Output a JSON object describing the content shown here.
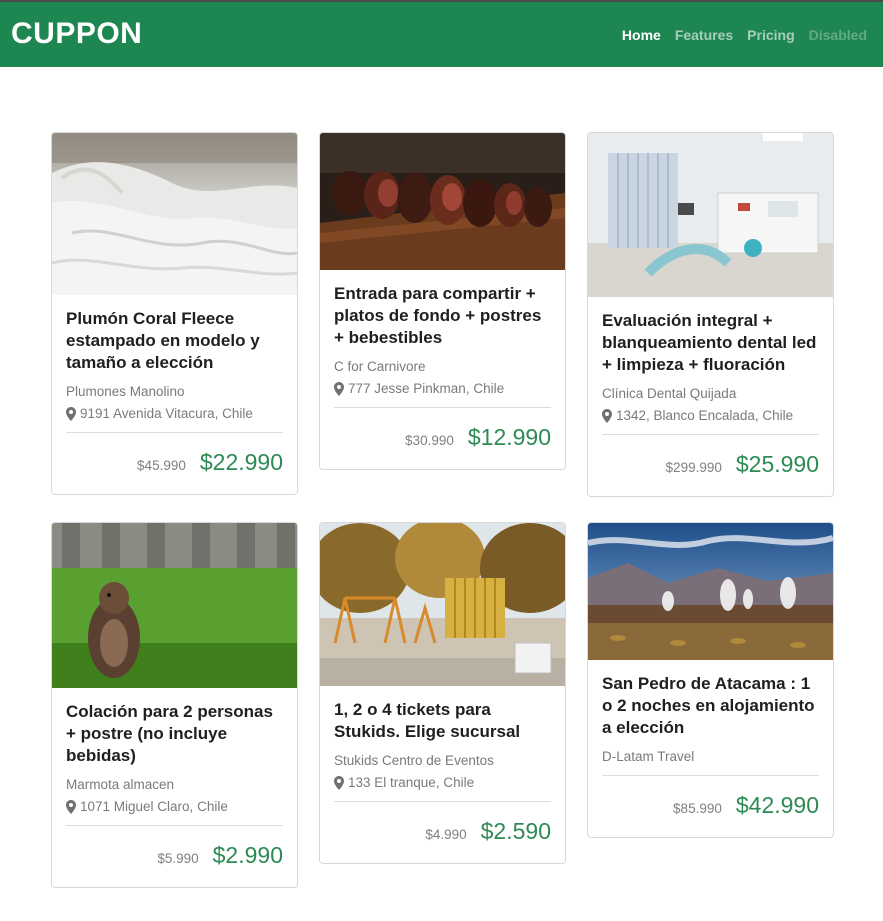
{
  "brand": "CUPPON",
  "nav": {
    "home": "Home",
    "features": "Features",
    "pricing": "Pricing",
    "disabled": "Disabled"
  },
  "colors": {
    "navbar": "#1e8650",
    "price": "#2e8a55"
  },
  "cards": [
    {
      "title": "Plumón Coral Fleece estampado en modelo y tamaño a elección",
      "company": "Plumones Manolino",
      "address": "9191 Avenida Vitacura, Chile",
      "old_price": "$45.990",
      "new_price": "$22.990",
      "image": "white bedding duvet"
    },
    {
      "title": "Entrada para compartir + platos de fondo + postres + bebestibles",
      "company": "C for Carnivore",
      "address": "777 Jesse Pinkman, Chile",
      "old_price": "$30.990",
      "new_price": "$12.990",
      "image": "sliced grilled steak"
    },
    {
      "title": "Evaluación integral + blanqueamiento dental led + limpieza + fluoración",
      "company": "Clínica Dental Quijada",
      "address": "1342, Blanco Encalada, Chile",
      "old_price": "$299.990",
      "new_price": "$25.990",
      "image": "dental clinic room"
    },
    {
      "title": "Colación para 2 personas + postre (no incluye bebidas)",
      "company": "Marmota almacen",
      "address": "1071 Miguel Claro, Chile",
      "old_price": "$5.990",
      "new_price": "$2.990",
      "image": "marmot on grass"
    },
    {
      "title": "1, 2 o 4 tickets para Stukids. Elige sucursal",
      "company": "Stukids Centro de Eventos",
      "address": "133 El tranque, Chile",
      "old_price": "$4.990",
      "new_price": "$2.590",
      "image": "outdoor playground"
    },
    {
      "title": "San Pedro de Atacama : 1 o 2 noches en alojamiento a elección",
      "company": "D-Latam Travel",
      "old_price": "$85.990",
      "new_price": "$42.990",
      "image": "atacama geysers landscape"
    }
  ]
}
